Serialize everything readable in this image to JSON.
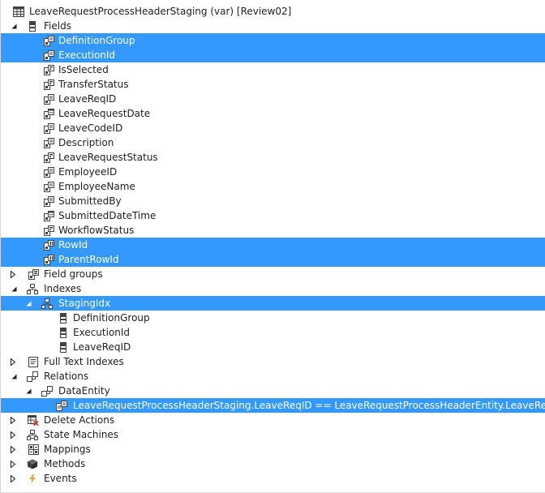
{
  "tree": {
    "root": {
      "label": "LeaveRequestProcessHeaderStaging (var) [Review02]",
      "icon": "table-icon"
    },
    "fields": {
      "label": "Fields",
      "icon": "field-group-node-icon",
      "items": [
        {
          "label": "DefinitionGroup",
          "icon": "field-string-icon",
          "selected": true
        },
        {
          "label": "ExecutionId",
          "icon": "field-string-icon",
          "selected": true
        },
        {
          "label": "IsSelected",
          "icon": "field-enum-icon",
          "selected": false
        },
        {
          "label": "TransferStatus",
          "icon": "field-enum-icon",
          "selected": false
        },
        {
          "label": "LeaveReqID",
          "icon": "field-string-icon",
          "selected": false
        },
        {
          "label": "LeaveRequestDate",
          "icon": "field-date-icon",
          "selected": false
        },
        {
          "label": "LeaveCodeID",
          "icon": "field-string-icon",
          "selected": false
        },
        {
          "label": "Description",
          "icon": "field-string-icon",
          "selected": false
        },
        {
          "label": "LeaveRequestStatus",
          "icon": "field-enum-icon",
          "selected": false
        },
        {
          "label": "EmployeeID",
          "icon": "field-string-icon",
          "selected": false
        },
        {
          "label": "EmployeeName",
          "icon": "field-string-icon",
          "selected": false
        },
        {
          "label": "SubmittedBy",
          "icon": "field-string-icon",
          "selected": false
        },
        {
          "label": "SubmittedDateTime",
          "icon": "field-date-icon",
          "selected": false
        },
        {
          "label": "WorkflowStatus",
          "icon": "field-enum-icon",
          "selected": false
        },
        {
          "label": "RowId",
          "icon": "field-int-icon",
          "selected": true
        },
        {
          "label": "ParentRowId",
          "icon": "field-int-icon",
          "selected": true
        }
      ]
    },
    "field_groups": {
      "label": "Field groups",
      "icon": "field-groups-icon"
    },
    "indexes": {
      "label": "Indexes",
      "icon": "indexes-icon",
      "index": {
        "label": "StagingIdx",
        "icon": "index-icon",
        "fields": [
          {
            "label": "DefinitionGroup",
            "icon": "index-field-icon"
          },
          {
            "label": "ExecutionId",
            "icon": "index-field-icon"
          },
          {
            "label": "LeaveReqID",
            "icon": "index-field-icon"
          }
        ]
      }
    },
    "full_text_indexes": {
      "label": "Full Text Indexes",
      "icon": "full-text-index-icon"
    },
    "relations": {
      "label": "Relations",
      "icon": "relations-icon",
      "relation": {
        "label": "DataEntity",
        "icon": "relation-icon",
        "constraint": {
          "label": "LeaveRequestProcessHeaderStaging.LeaveReqID == LeaveRequestProcessHeaderEntity.LeaveReqID",
          "icon": "relation-constraint-icon"
        }
      }
    },
    "delete_actions": {
      "label": "Delete Actions",
      "icon": "delete-actions-icon"
    },
    "state_machines": {
      "label": "State Machines",
      "icon": "state-machines-icon"
    },
    "mappings": {
      "label": "Mappings",
      "icon": "mappings-icon"
    },
    "methods": {
      "label": "Methods",
      "icon": "methods-icon"
    },
    "events": {
      "label": "Events",
      "icon": "events-icon"
    }
  },
  "colors": {
    "selection": "#3399ff",
    "selected_text": "#ffffff",
    "text": "#1e1e1e",
    "icon_dark": "#424242",
    "events_bolt": "#e8a33d",
    "delete_red": "#c8331e"
  }
}
